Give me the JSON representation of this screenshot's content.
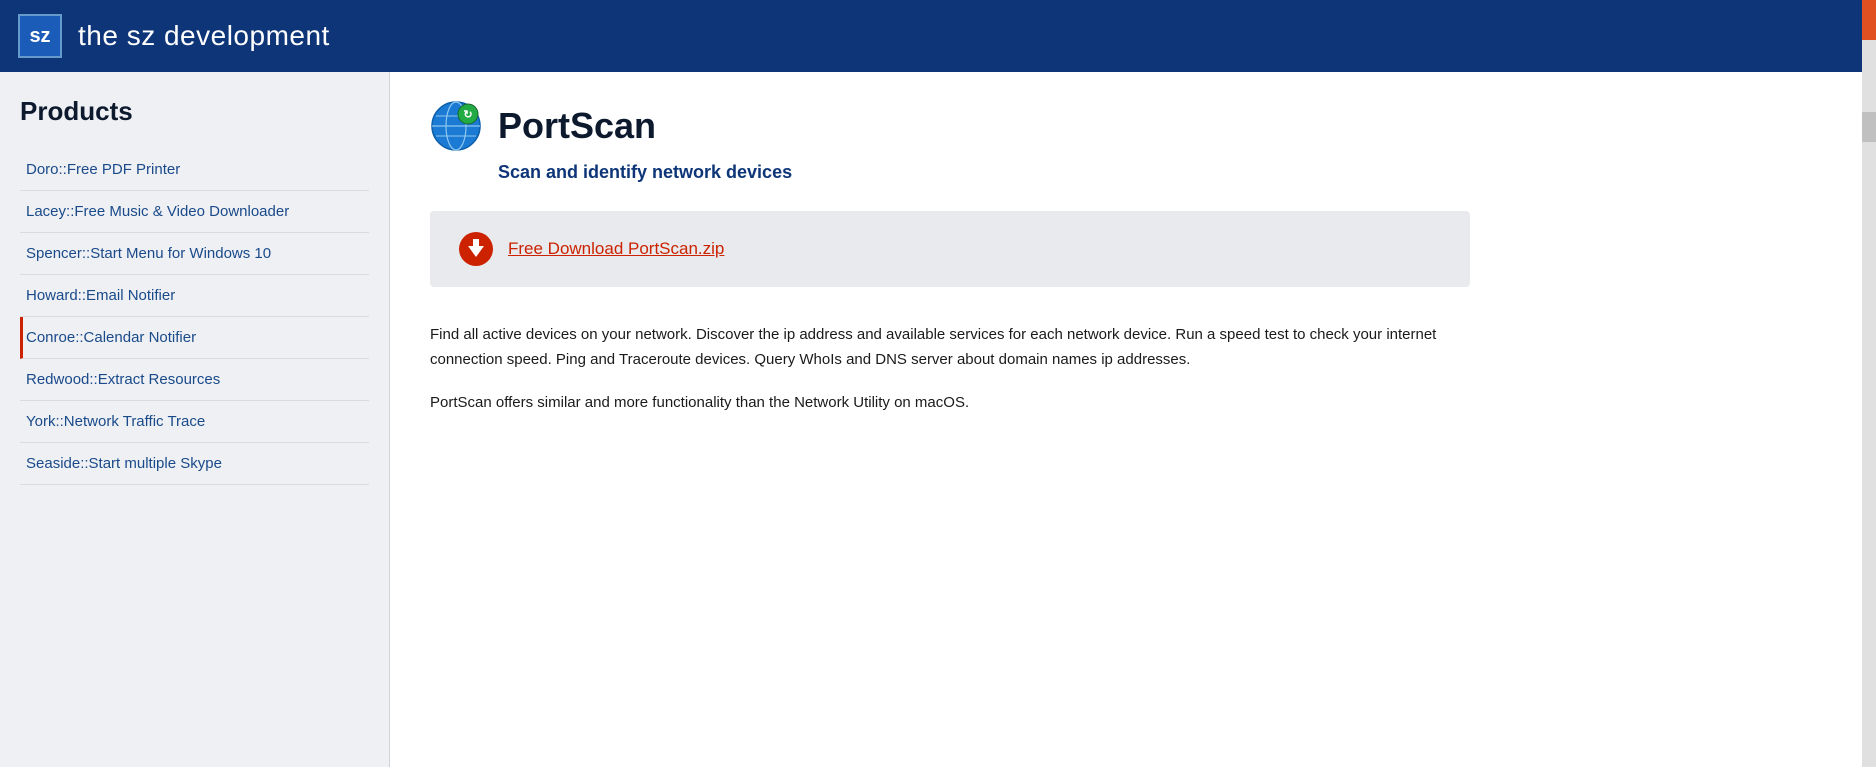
{
  "header": {
    "logo_text": "sz",
    "title": "the sz development"
  },
  "sidebar": {
    "heading": "Products",
    "items": [
      {
        "id": "doro",
        "label": "Doro::Free PDF Printer",
        "active": false
      },
      {
        "id": "lacey",
        "label": "Lacey::Free Music & Video Downloader",
        "active": false
      },
      {
        "id": "spencer",
        "label": "Spencer::Start Menu for Windows 10",
        "active": false
      },
      {
        "id": "howard",
        "label": "Howard::Email Notifier",
        "active": false
      },
      {
        "id": "conroe",
        "label": "Conroe::Calendar Notifier",
        "active": true
      },
      {
        "id": "redwood",
        "label": "Redwood::Extract Resources",
        "active": false
      },
      {
        "id": "york",
        "label": "York::Network Traffic Trace",
        "active": false
      },
      {
        "id": "seaside",
        "label": "Seaside::Start multiple Skype",
        "active": false
      }
    ]
  },
  "main": {
    "product_title": "PortScan",
    "product_subtitle": "Scan and identify network devices",
    "download_label": "Free Download PortScan.zip",
    "description_1": "Find all active devices on your network. Discover the ip address and available services for each network device. Run a speed test to check your internet connection speed. Ping and Traceroute devices. Query WhoIs and DNS server about domain names ip addresses.",
    "description_2": "PortScan offers similar and more functionality than the Network Utility on macOS."
  }
}
